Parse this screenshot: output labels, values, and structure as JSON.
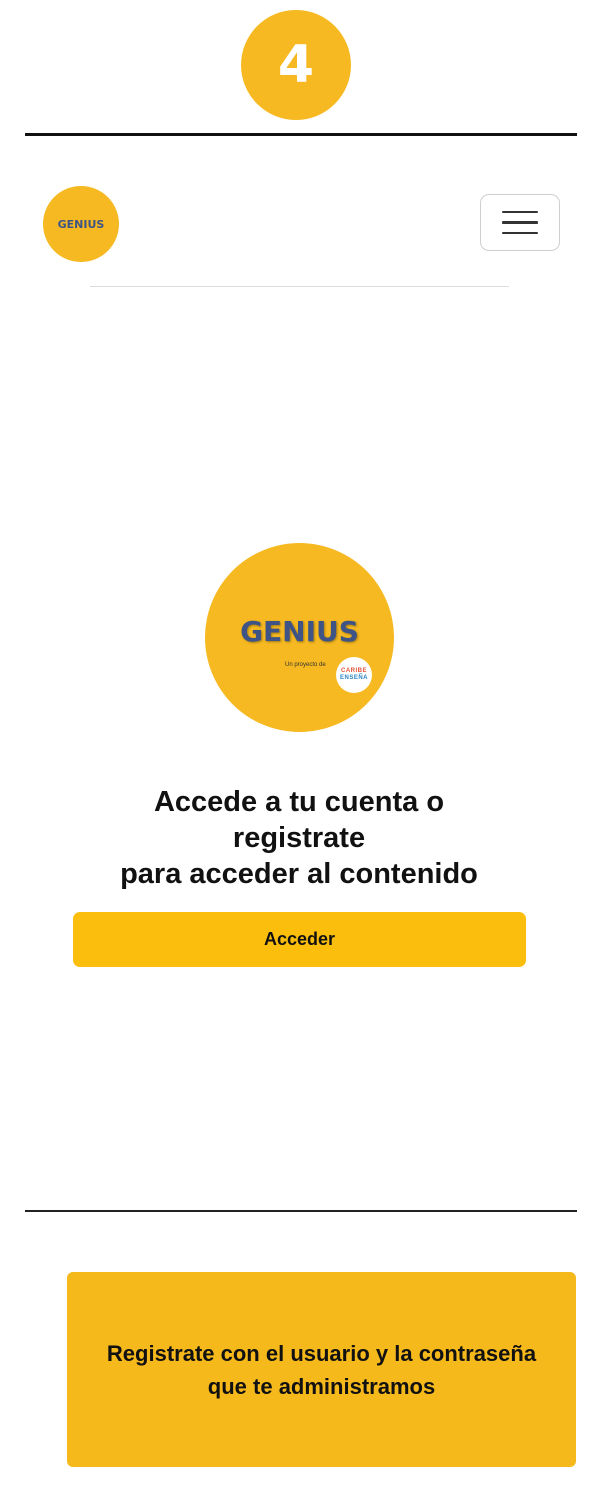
{
  "step": {
    "number": "4"
  },
  "navbar": {
    "logo_text": "GENIUS",
    "menu_icon": "hamburger-menu-icon"
  },
  "hero": {
    "logo_title": "GENIUS",
    "logo_subtitle": "Un proyecto de",
    "partner_line1": "CARIBE",
    "partner_line2": "ENSEÑA",
    "heading_lines": [
      "Accede a tu cuenta o",
      "registrate",
      "para acceder al contenido"
    ],
    "access_button_label": "Acceder"
  },
  "callout": {
    "lines": [
      "Registrate con el usuario y la contraseña",
      "que te administramos"
    ]
  },
  "colors": {
    "brand_yellow": "#f6b921",
    "button_yellow": "#fbbe0c",
    "logo_text_blue": "#3f5486"
  }
}
